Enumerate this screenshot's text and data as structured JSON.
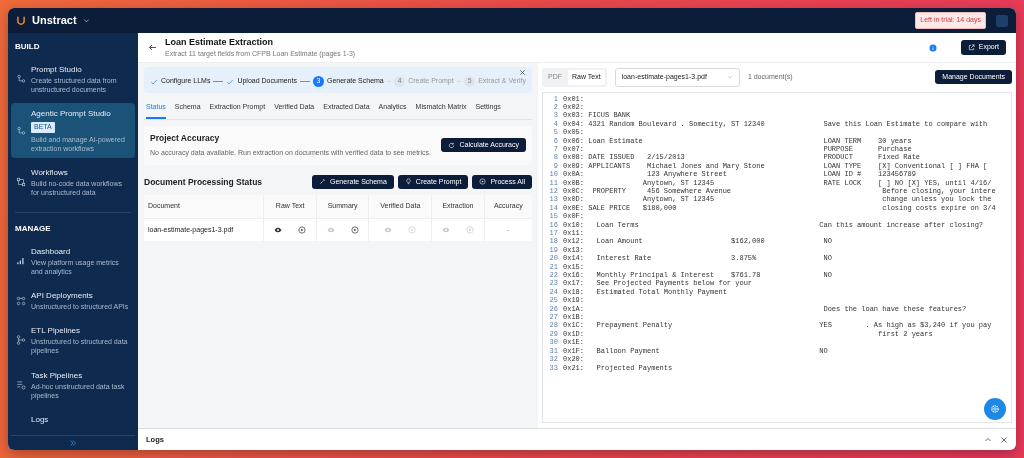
{
  "topbar": {
    "logo": "Unstract",
    "trial_badge": "Left in trial: 14 days"
  },
  "sidebar": {
    "sections": [
      {
        "heading": "BUILD",
        "items": [
          {
            "title": "Prompt Studio",
            "description": "Create structured data from unstructured documents",
            "selected": false
          },
          {
            "title": "Agentic Prompt Studio",
            "badge": "BETA",
            "description": "Build and manage AI-powered extraction workflows",
            "selected": true
          },
          {
            "title": "Workflows",
            "description": "Build no-code data workflows for unstructured data",
            "selected": false
          }
        ]
      },
      {
        "heading": "MANAGE",
        "items": [
          {
            "title": "Dashboard",
            "description": "View platform usage metrics and analytics",
            "selected": false
          },
          {
            "title": "API Deployments",
            "description": "Unstructured to structured APIs",
            "selected": false
          },
          {
            "title": "ETL Pipelines",
            "description": "Unstructured to structured data pipelines",
            "selected": false
          },
          {
            "title": "Task Pipelines",
            "description": "Ad-hoc unstructured data task pipelines",
            "selected": false
          },
          {
            "title": "Logs",
            "selected": false
          }
        ]
      }
    ]
  },
  "page_header": {
    "title": "Loan Estimate Extraction",
    "subtitle": "Extract 11 target fields from CFPB Loan Estimate (pages 1-3)",
    "export_button": "Export"
  },
  "stepper": {
    "steps": [
      {
        "label": "Configure LLMs",
        "completed": true
      },
      {
        "label": "Upload Documents",
        "completed": true
      },
      {
        "label": "Generate Schema",
        "completed": false,
        "active": true,
        "number": "3"
      },
      {
        "label": "Create Prompt",
        "completed": false,
        "active": false,
        "number": "4"
      },
      {
        "label": "Extract & Verify",
        "completed": false,
        "active": false,
        "number": "5"
      }
    ]
  },
  "tabs": [
    {
      "label": "Status",
      "selected": true
    },
    {
      "label": "Schema",
      "selected": false
    },
    {
      "label": "Extraction Prompt",
      "selected": false
    },
    {
      "label": "Verified Data",
      "selected": false
    },
    {
      "label": "Extracted Data",
      "selected": false
    },
    {
      "label": "Analytics",
      "selected": false
    },
    {
      "label": "Mismatch Matrix",
      "selected": false
    },
    {
      "label": "Settings",
      "selected": false
    }
  ],
  "project_accuracy": {
    "title": "Project Accuracy",
    "message": "No accuracy data available. Run extraction on documents with verified data to see metrics.",
    "button": "Calculate Accuracy"
  },
  "processing": {
    "title": "Document Processing Status",
    "buttons": [
      "Generate Schema",
      "Create Prompt",
      "Process All"
    ],
    "table": {
      "columns": [
        "Document",
        "Raw Text",
        "Summary",
        "Verified Data",
        "Extraction",
        "Accuracy"
      ],
      "rows": [
        {
          "document": "loan-estimate-pages1-3.pdf",
          "actions": [
            [
              {
                "kind": "view",
                "disabled": false
              },
              {
                "kind": "run",
                "disabled": false
              }
            ],
            [
              {
                "kind": "view",
                "disabled": true
              },
              {
                "kind": "run",
                "disabled": false
              }
            ],
            [
              {
                "kind": "view",
                "disabled": true
              },
              {
                "kind": "run",
                "disabled": true
              }
            ],
            [
              {
                "kind": "view",
                "disabled": true
              },
              {
                "kind": "run",
                "disabled": true
              }
            ]
          ],
          "accuracy": "-"
        }
      ]
    }
  },
  "viewer": {
    "modes": [
      {
        "label": "PDF",
        "selected": false
      },
      {
        "label": "Raw Text",
        "selected": true
      }
    ],
    "file_select": {
      "value": "loan-estimate-pages1-3.pdf"
    },
    "document_count": "1 document(s)",
    "manage_button": "Manage Documents",
    "lines": [
      {
        "number": "1",
        "text": "0x01:"
      },
      {
        "number": "2",
        "text": "0x02:"
      },
      {
        "number": "3",
        "text": "0x03: FICUS BANK"
      },
      {
        "number": "4",
        "text": "0x04: 4321 Random Boulevard . Somecity, ST 12340              Save this Loan Estimate to compare with"
      },
      {
        "number": "5",
        "text": "0x05:"
      },
      {
        "number": "6",
        "text": "0x06: Loan Estimate                                           LOAN TERM    30 years"
      },
      {
        "number": "7",
        "text": "0x07:                                                         PURPOSE      Purchase"
      },
      {
        "number": "8",
        "text": "0x08: DATE ISSUED   2/15/2013                                 PRODUCT      Fixed Rate"
      },
      {
        "number": "9",
        "text": "0x09: APPLICANTS    Michael Jones and Mary Stone              LOAN TYPE    [X] Conventional [ ] FHA ["
      },
      {
        "number": "10",
        "text": "0x0A:               123 Anywhere Street                       LOAN ID #    123456789"
      },
      {
        "number": "11",
        "text": "0x0B:              Anytown, ST 12345                          RATE LOCK    [ ] NO [X] YES, until 4/16/"
      },
      {
        "number": "12",
        "text": "0x0C:  PROPERTY     456 Somewhere Avenue                                    Before closing, your intere"
      },
      {
        "number": "13",
        "text": "0x0D:              Anytown, ST 12345                                        change unless you lock the"
      },
      {
        "number": "14",
        "text": "0x0E: SALE PRICE   $180,000                                                 closing costs expire on 3/4"
      },
      {
        "number": "15",
        "text": "0x0F:"
      },
      {
        "number": "16",
        "text": "0x10:   Loan Terms                                           Can this amount increase after closing?"
      },
      {
        "number": "17",
        "text": "0x11:"
      },
      {
        "number": "18",
        "text": "0x12:   Loan Amount                     $162,000              NO"
      },
      {
        "number": "19",
        "text": "0x13:"
      },
      {
        "number": "20",
        "text": "0x14:   Interest Rate                   3.875%                NO"
      },
      {
        "number": "21",
        "text": "0x15:"
      },
      {
        "number": "22",
        "text": "0x16:   Monthly Principal & Interest    $761.78               NO"
      },
      {
        "number": "23",
        "text": "0x17:   See Projected Payments below for your"
      },
      {
        "number": "24",
        "text": "0x18:   Estimated Total Monthly Payment"
      },
      {
        "number": "25",
        "text": "0x19:"
      },
      {
        "number": "26",
        "text": "0x1A:                                                         Does the loan have these features?"
      },
      {
        "number": "27",
        "text": "0x1B:"
      },
      {
        "number": "28",
        "text": "0x1C:   Prepayment Penalty                                   YES        . As high as $3,240 if you pay"
      },
      {
        "number": "29",
        "text": "0x1D:                                                                      first 2 years"
      },
      {
        "number": "30",
        "text": "0x1E:"
      },
      {
        "number": "31",
        "text": "0x1F:   Balloon Payment                                      NO"
      },
      {
        "number": "32",
        "text": "0x20:"
      },
      {
        "number": "33",
        "text": "0x21:   Projected Payments"
      }
    ]
  },
  "logs_panel": {
    "title": "Logs"
  }
}
